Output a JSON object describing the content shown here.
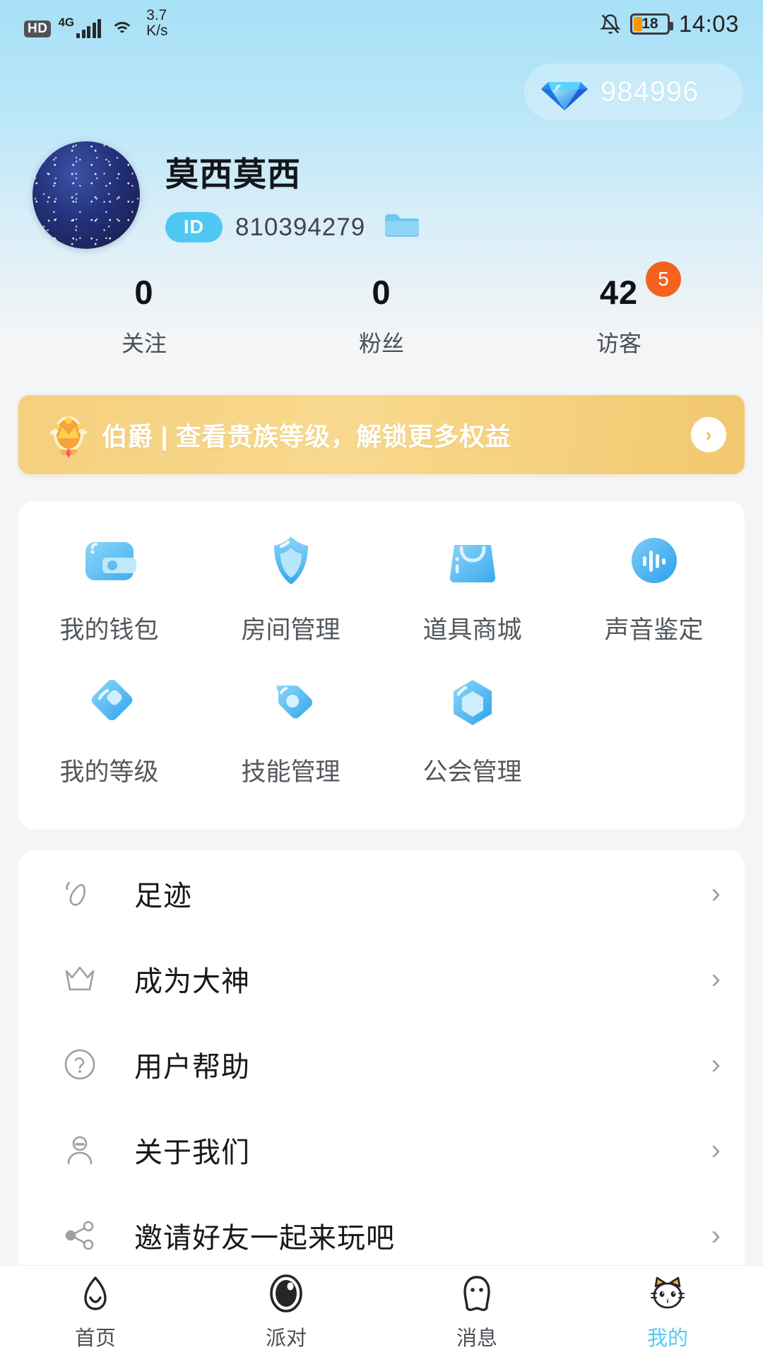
{
  "status_bar": {
    "hd_label": "HD",
    "network_type": "4G",
    "net_speed_value": "3.7",
    "net_speed_unit": "K/s",
    "mute_icon": "bell-muted-icon",
    "battery_level": "18",
    "time": "14:03"
  },
  "currency": {
    "icon": "diamond-icon",
    "amount": "984996"
  },
  "profile": {
    "avatar_icon": "avatar",
    "username": "莫西莫西",
    "id_badge": "ID",
    "id_number": "810394279",
    "folder_icon": "folder-icon"
  },
  "stats": [
    {
      "value": "0",
      "label": "关注",
      "badge": ""
    },
    {
      "value": "0",
      "label": "粉丝",
      "badge": ""
    },
    {
      "value": "42",
      "label": "访客",
      "badge": "5"
    }
  ],
  "noble_banner": {
    "icon": "noble-crown-icon",
    "text": "伯爵 | 查看贵族等级，解锁更多权益",
    "arrow": "›"
  },
  "grid": [
    {
      "label": "我的钱包",
      "icon": "wallet-icon"
    },
    {
      "label": "房间管理",
      "icon": "shield-icon"
    },
    {
      "label": "道具商城",
      "icon": "shopping-bag-icon"
    },
    {
      "label": "声音鉴定",
      "icon": "voice-wave-icon"
    },
    {
      "label": "我的等级",
      "icon": "diamond-level-icon"
    },
    {
      "label": "技能管理",
      "icon": "tag-icon"
    },
    {
      "label": "公会管理",
      "icon": "hexagon-icon"
    }
  ],
  "list": [
    {
      "label": "足迹",
      "icon": "footprint-icon",
      "arrow": "›"
    },
    {
      "label": "成为大神",
      "icon": "crown-outline-icon",
      "arrow": "›"
    },
    {
      "label": "用户帮助",
      "icon": "question-circle-icon",
      "arrow": "›"
    },
    {
      "label": "关于我们",
      "icon": "person-icon",
      "arrow": "›"
    },
    {
      "label": "邀请好友一起来玩吧",
      "icon": "share-icon",
      "arrow": "›"
    }
  ],
  "tabs": [
    {
      "label": "首页",
      "icon": "home-icon",
      "active": false
    },
    {
      "label": "派对",
      "icon": "party-icon",
      "active": false
    },
    {
      "label": "消息",
      "icon": "message-icon",
      "active": false
    },
    {
      "label": "我的",
      "icon": "cat-icon",
      "active": true
    }
  ],
  "colors": {
    "accent": "#56c9ef",
    "badge": "#f4621f",
    "noble_gold": "#f5cf7e",
    "header_top": "#a7e0f7"
  }
}
